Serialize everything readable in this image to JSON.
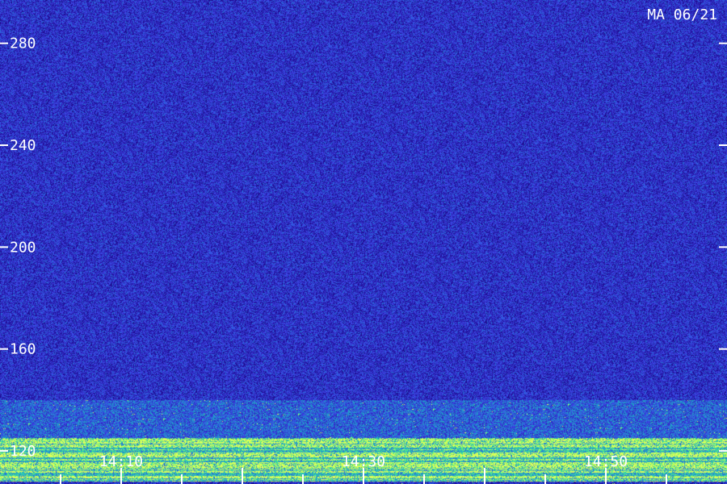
{
  "chart_data": {
    "type": "heatmap",
    "title": "MA 06/21",
    "xlabel": "",
    "ylabel": "",
    "y_ticks": [
      120,
      160,
      200,
      240,
      280
    ],
    "y_tick_labels": [
      "120",
      "160",
      "200",
      "240",
      "280"
    ],
    "ylim": [
      107,
      297
    ],
    "x_ticks": [
      "14:10",
      "14:30",
      "14:50"
    ],
    "x_tick_labels": [
      "14:10",
      "14:30",
      "14:50"
    ],
    "x_minor_tick_count": 12,
    "xlim": [
      "14:00",
      "15:00"
    ],
    "grid": false,
    "intensity_scale": "blue-to-green-to-yellow",
    "colors": {
      "background": "#1a0a6e",
      "noise_high": "#3a3ae0",
      "band_mid": "#1ec8c8",
      "band_high": "#8cff5a",
      "peak": "#f0ff60",
      "text": "#ffffff"
    },
    "features": [
      {
        "kind": "broadband_noise",
        "y_range": [
          107,
          297
        ],
        "level": 0.25
      },
      {
        "kind": "stronger_band",
        "y_range": [
          108,
          125
        ],
        "level": 0.75
      },
      {
        "kind": "weak_glow",
        "y_range": [
          125,
          140
        ],
        "level": 0.45
      }
    ]
  }
}
